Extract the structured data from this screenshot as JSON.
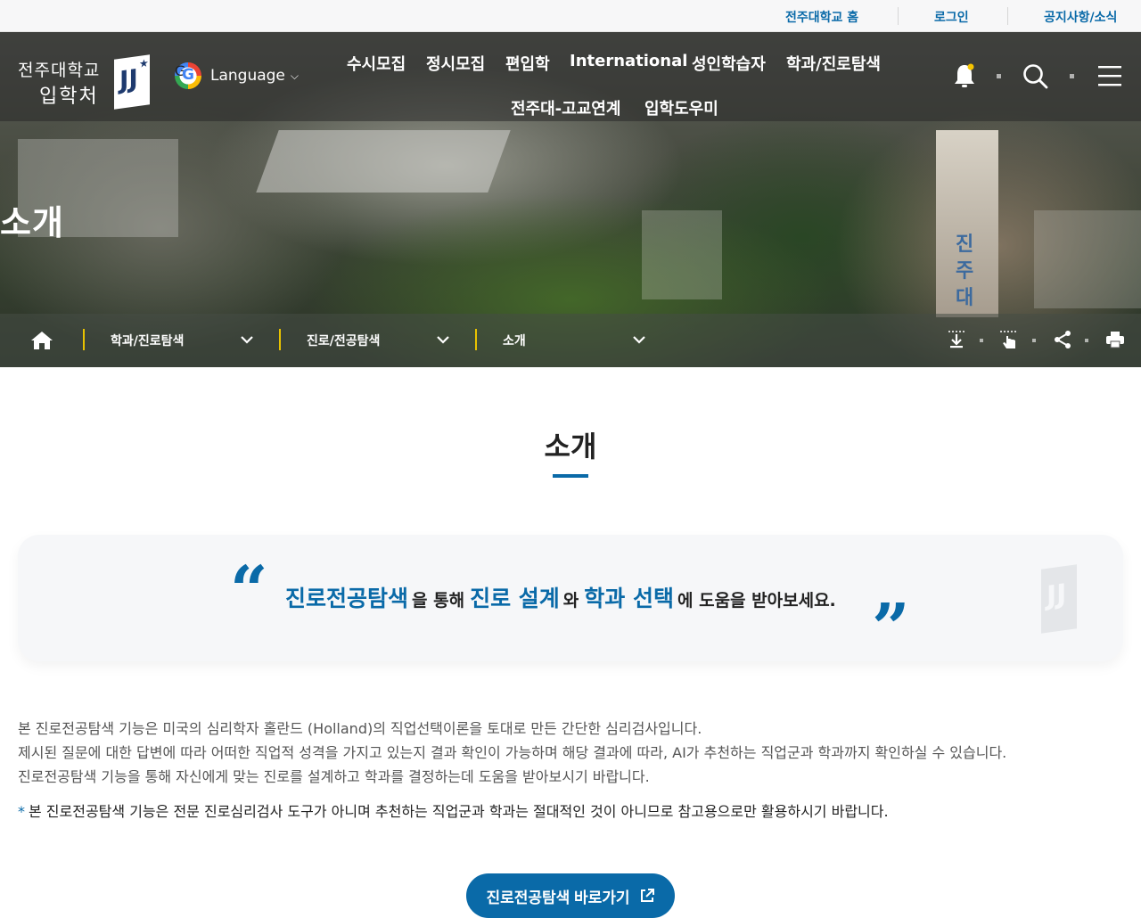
{
  "topbar": {
    "home_link": "전주대학교 홈",
    "login_link": "로그인",
    "notice_link": "공지사항/소식"
  },
  "logo": {
    "line1": "전주대학교",
    "line2": "입학처",
    "mark": "JJ"
  },
  "language": {
    "label": "Language",
    "google_letter": "G"
  },
  "gnb": {
    "items": [
      "수시모집",
      "정시모집",
      "편입학",
      "International",
      "성인학습자",
      "학과/진로탐색",
      "전주대-고교연계",
      "입학도우미"
    ]
  },
  "hero": {
    "title": "소개",
    "tower_text": [
      "진",
      "주",
      "대"
    ]
  },
  "breadcrumb": {
    "level1": "학과/진로탐색",
    "level2": "진로/전공탐색",
    "level3": "소개"
  },
  "page": {
    "title": "소개"
  },
  "quote": {
    "part1": "진로전공탐색",
    "conn1": "을 통해",
    "part2": "진로 설계",
    "conn2": "와",
    "part3": "학과 선택",
    "conn3": "에 도움을 받아보세요."
  },
  "description": {
    "line1": "본 진로전공탐색 기능은 미국의 심리학자 홀란드 (Holland)의 직업선택이론을 토대로 만든 간단한 심리검사입니다.",
    "line2": "제시된 질문에 대한 답변에 따라 어떠한 직업적 성격을 가지고 있는지 결과 확인이 가능하며 해당 결과에 따라, AI가 추천하는 직업군과 학과까지 확인하실 수 있습니다.",
    "line3": "진로전공탐색 기능을 통해 자신에게 맞는 진로를 설계하고 학과를 결정하는데 도움을 받아보시기 바랍니다."
  },
  "note": {
    "marker": "*",
    "text": "본 진로전공탐색 기능은 전문 진로심리검사 도구가 아니며 추천하는 직업군과 학과는 절대적인 것이 아니므로 참고용으로만 활용하시기 바랍니다."
  },
  "cta": {
    "label": "진로전공탐색 바로가기"
  },
  "colors": {
    "accent": "#0a6aa8",
    "breadcrumb_separator": "#e8c200",
    "notification_dot": "#f5c400"
  },
  "icons": [
    "google-icon",
    "bell-icon",
    "search-icon",
    "menu-icon",
    "home-icon",
    "chevron-down-icon",
    "download-icon",
    "touch-icon",
    "share-icon",
    "print-icon",
    "external-link-icon"
  ]
}
